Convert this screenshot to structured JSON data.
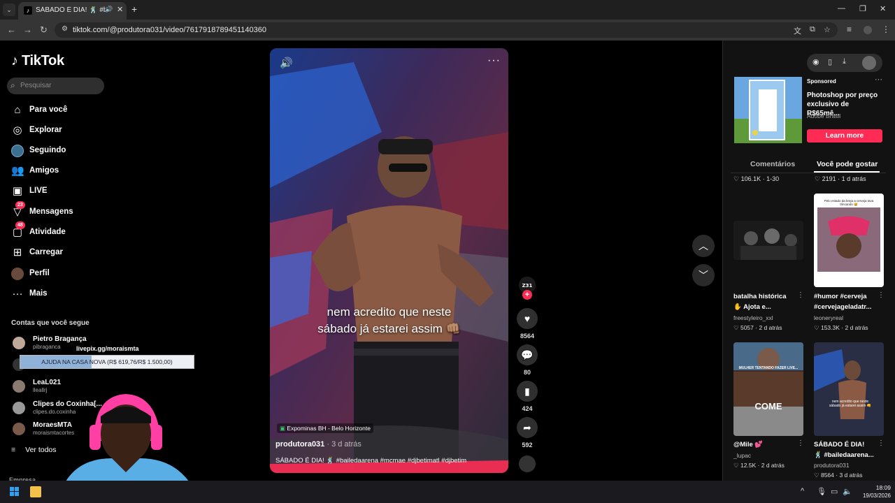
{
  "browser": {
    "tab_title": "SÁBADO É DIA! 🕺 #bailedaarena",
    "new_tab": "+",
    "url": "tiktok.com/@produtora031/video/7617918789451140360",
    "minimize": "—",
    "restore": "❐",
    "close": "✕"
  },
  "sidebar": {
    "logo": "TikTok",
    "search_placeholder": "Pesquisar",
    "nav": [
      {
        "label": "Para você",
        "icon": "home-icon"
      },
      {
        "label": "Explorar",
        "icon": "compass-icon"
      },
      {
        "label": "Seguindo",
        "icon": "following-avatar-icon"
      },
      {
        "label": "Amigos",
        "icon": "friends-icon"
      },
      {
        "label": "LIVE",
        "icon": "live-icon"
      },
      {
        "label": "Mensagens",
        "icon": "messages-icon",
        "badge": "23"
      },
      {
        "label": "Atividade",
        "icon": "activity-icon",
        "badge": "48"
      },
      {
        "label": "Carregar",
        "icon": "upload-icon"
      },
      {
        "label": "Perfil",
        "icon": "profile-avatar-icon"
      },
      {
        "label": "Mais",
        "icon": "more-dots-icon"
      }
    ],
    "following_title": "Contas que você segue",
    "following": [
      {
        "name": "Pietro Bragança",
        "handle": "pibraganca"
      },
      {
        "name": "",
        "handle": ""
      },
      {
        "name": "LeaL021",
        "handle": "lleallrj"
      },
      {
        "name": "Clipes do Coxinha[...",
        "handle": "clipes.do.coxinha"
      },
      {
        "name": "MoraesMTA",
        "handle": "moraismtacortes"
      }
    ],
    "see_all": "Ver todos",
    "footer_section": "Empresa"
  },
  "overlay": {
    "link": "livepix.gg/moraismta",
    "donation_text": "AJUDA NA CASA NOVA (R$ 619,76/R$ 1.500,00)",
    "donation_progress": 0.413
  },
  "video": {
    "caption_line1": "nem acredito que neste",
    "caption_line2": "sábado já estarei assim 👊🏽",
    "location": "Expominas BH - Belo Horizonte",
    "author": "produtora031",
    "date": " · 3 d atrás",
    "description": "SÁBADO É DIA! 🕺 #bailedaarena #mcmae #djbetimatl #djbetim",
    "likes": "8564",
    "comments": "80",
    "saves": "424",
    "shares": "592"
  },
  "right_panel": {
    "sponsored": "Sponsored",
    "ad_title": "Photoshop por preço exclusivo de R$65mê...",
    "ad_brand": "Adobe Brasil",
    "learn_more": "Learn more",
    "tab_comments": "Comentários",
    "tab_recommend": "Você pode gostar",
    "stat_left": "♡ 106.1K · 1-30",
    "stat_right": "♡ 2191 · 1 d atrás",
    "cards": [
      {
        "title": "batalha histórica ✋ Ajota e...",
        "author": "freestyleiro_xxl",
        "stats": "♡ 5057 · 2 d atrás"
      },
      {
        "title": "#humor #cerveja #cervejageladatr...",
        "author": "leoneryreal",
        "stats": "♡ 153.3K · 2 d atrás",
        "thumb_text": "Pelo estado da breja a cerveja tava trincando 😅"
      },
      {
        "title": "@Mile 💕",
        "author": "_lupac",
        "stats": "♡ 12.5K · 2 d atrás",
        "thumb_text": "COME",
        "thumb_sub": "MULHER TENTANDO FAZER LIVE..."
      },
      {
        "title": "SÁBADO É DIA! 🕺 #bailedaarena...",
        "author": "produtora031",
        "stats": "♡ 8564 · 3 d atrás",
        "thumb_text": "nem acredito que neste sábado já estarei assim 👊"
      }
    ]
  },
  "taskbar": {
    "time": "18:09",
    "date": "19/03/2026"
  },
  "colors": {
    "accent": "#fe2c55",
    "background": "#000000"
  }
}
